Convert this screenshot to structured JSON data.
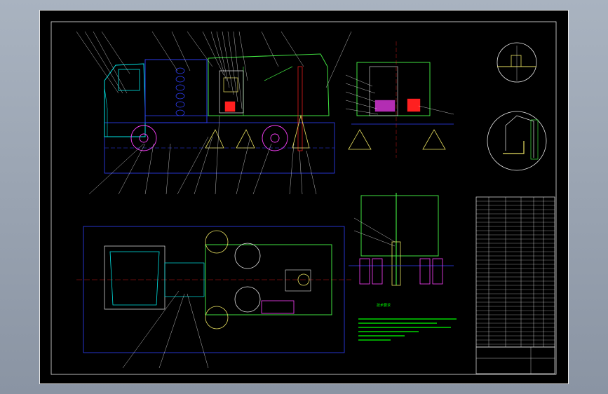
{
  "drawing": {
    "notes_title": "技术要求",
    "title_block": "",
    "colors": {
      "outline_white": "#e8e8e8",
      "cab_cyan": "#00e5e5",
      "frame_blue": "#3040ff",
      "tank_green": "#40e040",
      "brush_yellow": "#e8e060",
      "accent_red": "#ff2020",
      "accent_magenta": "#ff40ff",
      "notes_green": "#00ff00"
    },
    "icons": [
      "truck-side-view",
      "truck-rear-view",
      "truck-top-view",
      "truck-front-view",
      "detail-circle-a",
      "detail-circle-b",
      "parts-list-table"
    ]
  }
}
